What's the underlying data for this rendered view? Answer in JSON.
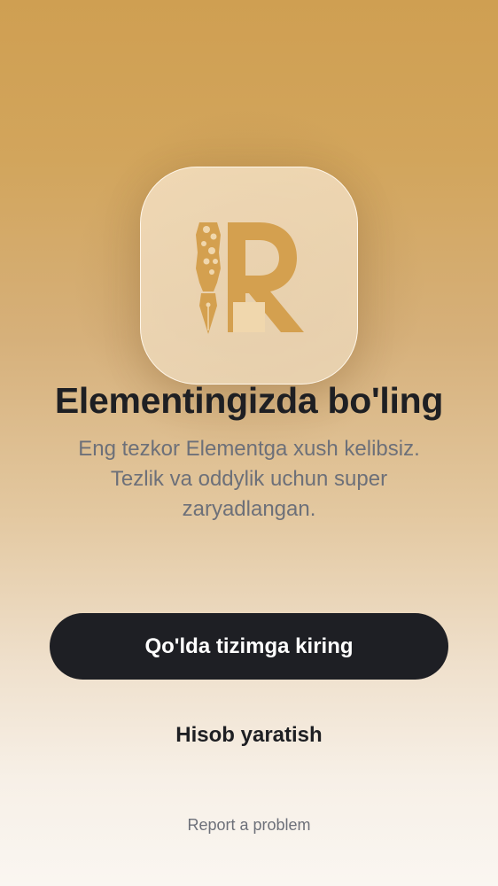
{
  "app": {
    "logo_icon": "pen-r-logo-icon",
    "accent_color": "#d4a04f"
  },
  "welcome": {
    "title": "Elementingizda bo'ling",
    "subtitle": "Eng tezkor Elementga xush kelibsiz. Tezlik va oddylik uchun super zaryadlangan."
  },
  "actions": {
    "primary_label": "Qo'lda tizimga kiring",
    "secondary_label": "Hisob yaratish",
    "report_label": "Report a problem"
  }
}
